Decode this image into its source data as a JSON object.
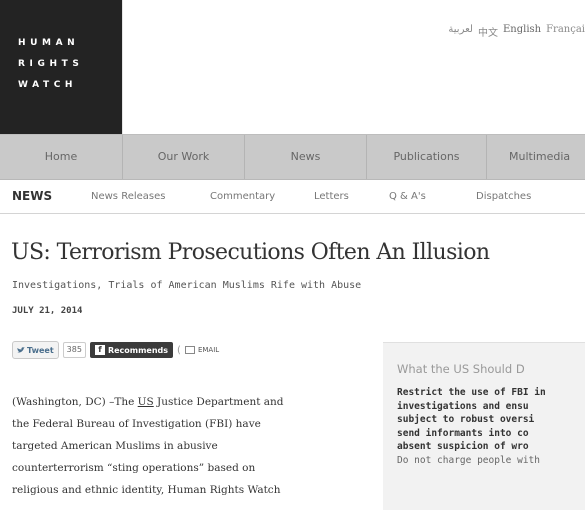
{
  "logo": {
    "lines": [
      "HUMAN",
      "RIGHTS",
      "WATCH"
    ]
  },
  "languages": [
    "لعربية",
    "中文",
    "English",
    "Françai"
  ],
  "nav": [
    "Home",
    "Our Work",
    "News",
    "Publications",
    "Multimedia"
  ],
  "subnav": [
    "NEWS",
    "News Releases",
    "Commentary",
    "Letters",
    "Q & A's",
    "Dispatches"
  ],
  "article": {
    "title": "US: Terrorism Prosecutions Often An Illusion",
    "subtitle": "Investigations, Trials of American Muslims Rife with Abuse",
    "date": "JULY 21, 2014",
    "body_lines": [
      {
        "pre": "(Washington, DC) –The ",
        "link": "US",
        "post": " Justice Department and"
      },
      {
        "pre": "the Federal Bureau of Investigation (FBI) have",
        "link": "",
        "post": ""
      },
      {
        "pre": "targeted American Muslims in abusive",
        "link": "",
        "post": ""
      },
      {
        "pre": "counterterrorism “sting operations” based on",
        "link": "",
        "post": ""
      },
      {
        "pre": "religious and ethnic identity, Human Rights Watch",
        "link": "",
        "post": ""
      }
    ]
  },
  "share": {
    "tweet": "Tweet",
    "tweet_count": "385",
    "recommend": "Rec",
    "recommend_bold": "omme",
    "recommend_suffix": "nds",
    "recommend_icon": "f",
    "email": "EMAIL"
  },
  "sidebar": {
    "title": "What the US Should D",
    "bold_lines": [
      "Restrict the use of FBI in",
      "investigations and ensu",
      "subject to robust oversi",
      "send informants into co",
      "absent suspicion of wro"
    ],
    "normal_line": "Do not charge people with"
  },
  "colors": {
    "logo_bg": "#232323",
    "nav_bg": "#c9c9c9",
    "sidebar_bg": "#f2f2f2"
  }
}
